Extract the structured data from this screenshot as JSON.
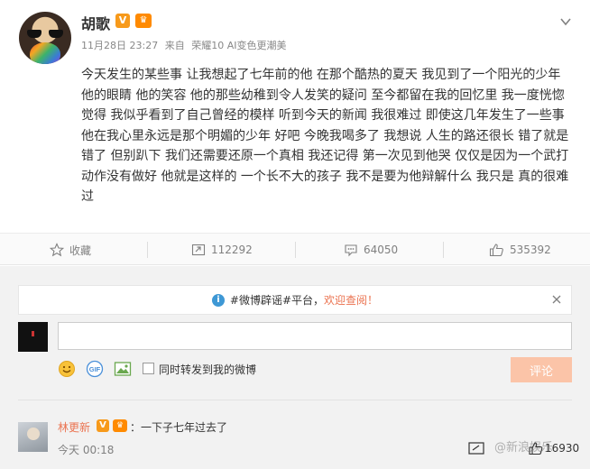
{
  "post": {
    "author": "胡歌",
    "verified_badge": "V",
    "member_badge": "♛",
    "time": "11月28日 23:27",
    "via_label": "来自",
    "device": "荣耀10 AI变色更潮美",
    "content": "今天发生的某些事 让我想起了七年前的他 在那个酷热的夏天 我见到了一个阳光的少年 他的眼睛 他的笑容 他的那些幼稚到令人发笑的疑问 至今都留在我的回忆里 我一度恍惚觉得 我似乎看到了自己曾经的模样 听到今天的新闻 我很难过 即使这几年发生了一些事 他在我心里永远是那个明媚的少年 好吧 今晚我喝多了 我想说 人生的路还很长 错了就是错了 但别趴下 我们还需要还原一个真相 我还记得 第一次见到他哭 仅仅是因为一个武打动作没有做好 他就是这样的 一个长不大的孩子 我不是要为他辩解什么 我只是 真的很难过"
  },
  "actions": {
    "favorite_label": "收藏",
    "repost_count": "112292",
    "comment_count": "64050",
    "like_count": "535392"
  },
  "comments": {
    "notice_prefix": "#微博辟谣#平台，",
    "notice_link": "欢迎查阅！",
    "input_placeholder": "",
    "forward_label": "同时转发到我的微博",
    "submit_label": "评论",
    "items": [
      {
        "author": "林更新",
        "verified_badge": "V",
        "member_badge": "♛",
        "text": "：一下子七年过去了",
        "time": "今天 00:18",
        "likes": "16930"
      }
    ],
    "watermark": "@新浪娱乐"
  },
  "colors": {
    "accent": "#eb7350",
    "badge_orange": "#f79a1b",
    "submit_disabled": "#fbc4a8",
    "info_blue": "#3e98d5"
  }
}
